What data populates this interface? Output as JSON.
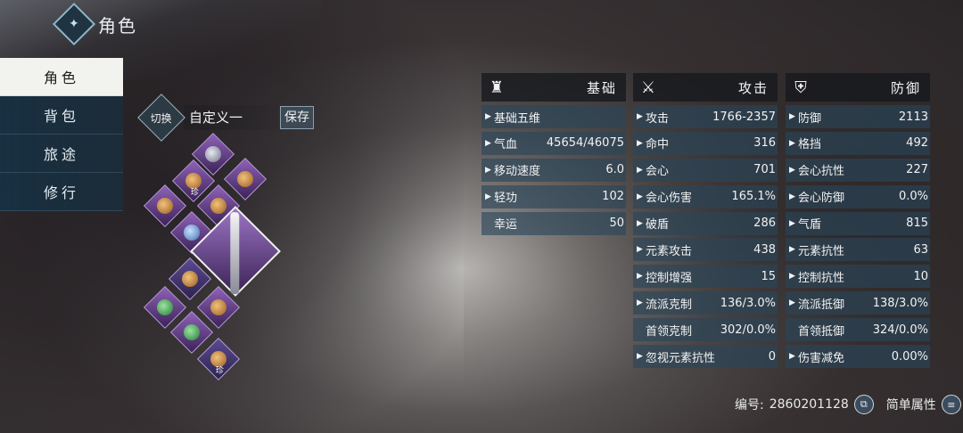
{
  "header": {
    "title": "角色",
    "logo_icon": "diamond-feather-icon"
  },
  "nav": {
    "items": [
      {
        "label": "角色",
        "active": true
      },
      {
        "label": "背包",
        "active": false
      },
      {
        "label": "旅途",
        "active": false
      },
      {
        "label": "修行",
        "active": false
      }
    ]
  },
  "set": {
    "switch_label": "切换",
    "name": "自定义一",
    "save_label": "保存"
  },
  "equipment": {
    "big_badge": "",
    "small_badge": "珍",
    "small_badge2": "珍"
  },
  "stats": {
    "basic": {
      "title": "基础",
      "icon": "robe-icon",
      "rows": [
        {
          "label": "基础五维",
          "value": "",
          "arrow": true
        },
        {
          "label": "气血",
          "value": "45654/46075",
          "arrow": true
        },
        {
          "label": "移动速度",
          "value": "6.0",
          "arrow": true
        },
        {
          "label": "轻功",
          "value": "102",
          "arrow": true
        },
        {
          "label": "幸运",
          "value": "50",
          "arrow": false
        }
      ]
    },
    "attack": {
      "title": "攻击",
      "icon": "crossed-swords-icon",
      "rows": [
        {
          "label": "攻击",
          "value": "1766-2357",
          "arrow": true
        },
        {
          "label": "命中",
          "value": "316",
          "arrow": true
        },
        {
          "label": "会心",
          "value": "701",
          "arrow": true
        },
        {
          "label": "会心伤害",
          "value": "165.1%",
          "arrow": true
        },
        {
          "label": "破盾",
          "value": "286",
          "arrow": true
        },
        {
          "label": "元素攻击",
          "value": "438",
          "arrow": true
        },
        {
          "label": "控制增强",
          "value": "15",
          "arrow": true
        },
        {
          "label": "流派克制",
          "value": "136/3.0%",
          "arrow": true
        },
        {
          "label": "首领克制",
          "value": "302/0.0%",
          "arrow": false
        },
        {
          "label": "忽视元素抗性",
          "value": "0",
          "arrow": true
        }
      ]
    },
    "defense": {
      "title": "防御",
      "icon": "shield-icon",
      "rows": [
        {
          "label": "防御",
          "value": "2113",
          "arrow": true
        },
        {
          "label": "格挡",
          "value": "492",
          "arrow": true
        },
        {
          "label": "会心抗性",
          "value": "227",
          "arrow": true
        },
        {
          "label": "会心防御",
          "value": "0.0%",
          "arrow": true
        },
        {
          "label": "气盾",
          "value": "815",
          "arrow": true
        },
        {
          "label": "元素抗性",
          "value": "63",
          "arrow": true
        },
        {
          "label": "控制抗性",
          "value": "10",
          "arrow": true
        },
        {
          "label": "流派抵御",
          "value": "138/3.0%",
          "arrow": true
        },
        {
          "label": "首领抵御",
          "value": "324/0.0%",
          "arrow": false
        },
        {
          "label": "伤害减免",
          "value": "0.00%",
          "arrow": true
        }
      ]
    }
  },
  "footer": {
    "id_label": "编号:",
    "id_value": "2860201128",
    "simple_label": "简单属性"
  }
}
